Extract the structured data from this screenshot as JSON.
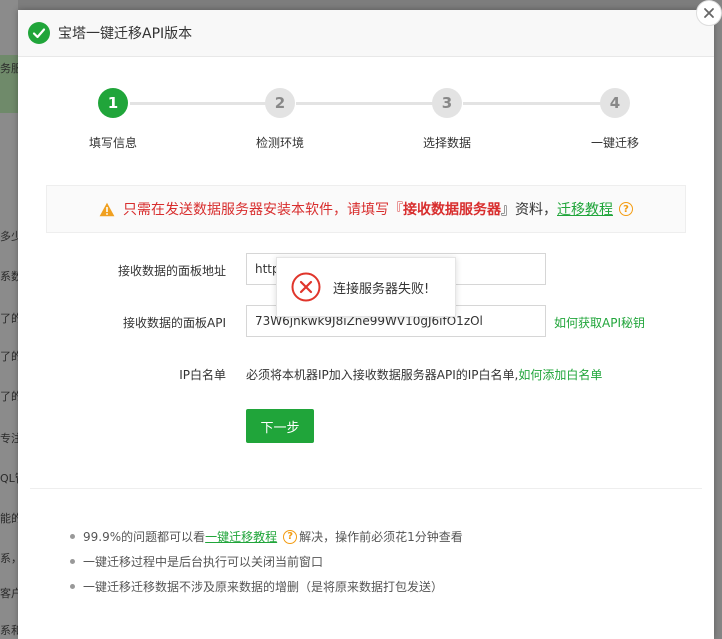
{
  "background": {
    "labels": [
      "务服",
      "多少",
      "系数",
      "了的",
      "了的",
      "了的",
      "专注",
      "QL管",
      "能的",
      "系，",
      "客户",
      "系和"
    ]
  },
  "dialog": {
    "title": "宝塔一键迁移API版本",
    "steps": [
      {
        "num": "1",
        "label": "填写信息",
        "active": true
      },
      {
        "num": "2",
        "label": "检测环境",
        "active": false
      },
      {
        "num": "3",
        "label": "选择数据",
        "active": false
      },
      {
        "num": "4",
        "label": "一键迁移",
        "active": false
      }
    ],
    "warning": {
      "text_a": "只需在发送数据服务器安装本软件，请填写『",
      "bold": "接收数据服务器",
      "text_b": "』资料，",
      "tutorial_link": "迁移教程"
    },
    "form": {
      "panel_url_label": "接收数据的面板地址",
      "panel_url_value": "http",
      "api_label": "接收数据的面板API",
      "api_value": "73W6jnkwk9J8iZne99WV10gJ6ifO1zOl",
      "api_help_link": "如何获取API秘钥",
      "ip_label": "IP白名单",
      "ip_note": "必须将本机器IP加入接收数据服务器API的IP白名单,",
      "ip_help_link": "如何添加白名单",
      "next_button": "下一步"
    },
    "tips": {
      "tip1_a": "99.9%的问题都可以看",
      "tip1_link": "一键迁移教程",
      "tip1_b": "解决，操作前必须花1分钟查看",
      "tip2": "一键迁移过程中是后台执行可以关闭当前窗口",
      "tip3": "一键迁移迁移数据不涉及原来数据的增删（是将原来数据打包发送）"
    }
  },
  "toast": {
    "message": "连接服务器失败!"
  },
  "colors": {
    "accent": "#20a53a",
    "warning_red": "#d82e2e",
    "error_icon": "#e0352b",
    "help_orange": "#f39c12"
  }
}
